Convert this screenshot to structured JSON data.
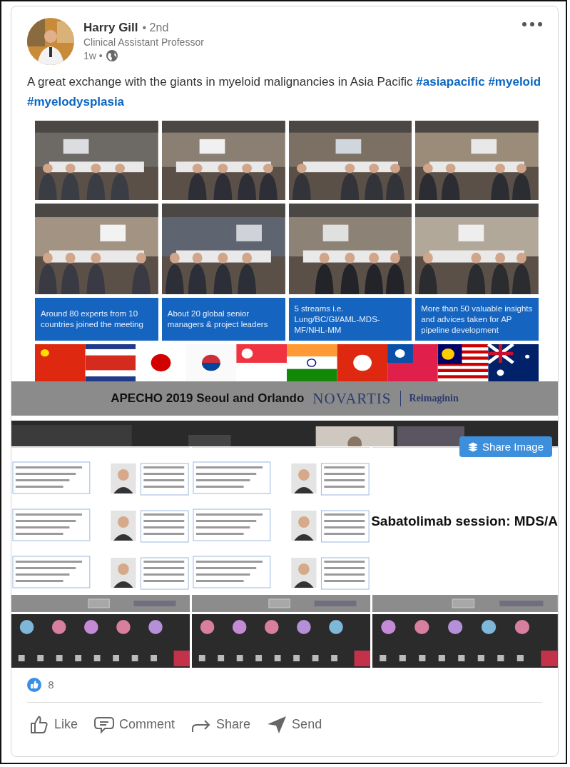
{
  "author": {
    "name": "Harry Gill",
    "degree": "• 2nd",
    "headline": "Clinical Assistant Professor",
    "time": "1w •"
  },
  "post": {
    "text": "A great exchange with the giants in myeloid malignancies in Asia Pacific",
    "hashtags": [
      "#asiapacific",
      "#myeloid",
      "#myelodysplasia"
    ]
  },
  "image": {
    "stat_boxes": [
      "Around 80 experts from 10 countries joined the meeting",
      "About 20 global senior managers & project leaders",
      "5 streams i.e. Lung/BC/GI/AML-MDS-MF/NHL-MM",
      "More than 50 valuable insights and advices  taken for AP pipeline development"
    ],
    "banner": {
      "title": "APECHO 2019 Seoul and Orlando",
      "brand": "NOVARTIS",
      "tagline": "Reimaginin"
    },
    "share_button": {
      "label": "Share Image"
    },
    "call_panels": [
      {
        "kind": "speakers"
      },
      {
        "kind": "speakers"
      },
      {
        "kind": "title",
        "title": "Sabatolimab session: MDS/A"
      }
    ]
  },
  "reactions": {
    "count": "8"
  },
  "actions": [
    {
      "kind": "like",
      "label": "Like"
    },
    {
      "kind": "comment",
      "label": "Comment"
    },
    {
      "kind": "share",
      "label": "Share"
    },
    {
      "kind": "send",
      "label": "Send"
    }
  ]
}
